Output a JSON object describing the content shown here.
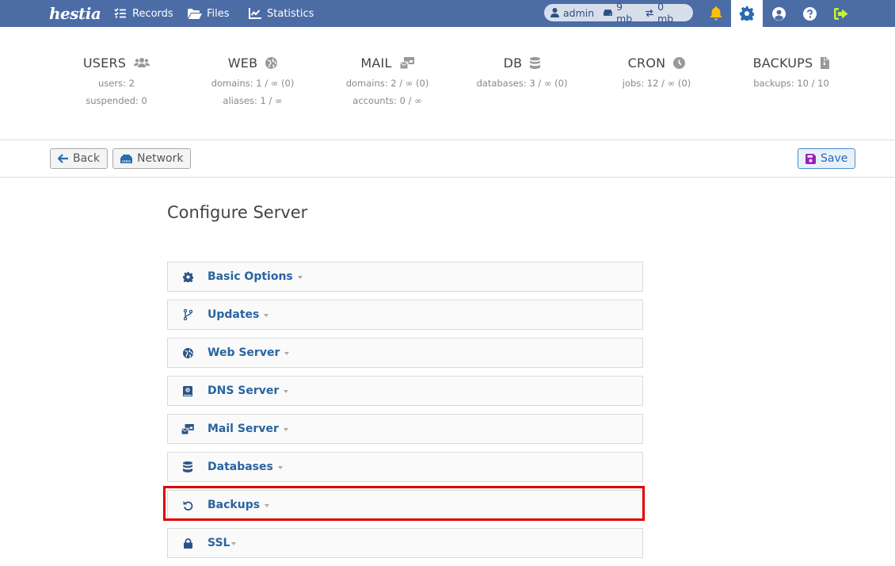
{
  "topbar": {
    "logo": "hestia",
    "nav": [
      {
        "label": "Records",
        "icon": "list-check-icon"
      },
      {
        "label": "Files",
        "icon": "folder-open-icon"
      },
      {
        "label": "Statistics",
        "icon": "chart-line-icon"
      }
    ],
    "user_pill": {
      "user": "admin",
      "disk": "9 mb",
      "bandwidth": "0 mb"
    },
    "icons": [
      "bell-icon",
      "gear-icon",
      "user-circle-icon",
      "help-icon",
      "logout-icon"
    ],
    "colors": {
      "bar": "#4c6ca6",
      "bell": "#ffc107",
      "logout": "#c6f03a",
      "active_gear": "#2a6ab0"
    }
  },
  "stats": [
    {
      "title": "USERS",
      "icon": "users-icon",
      "lines": [
        "users: 2",
        "suspended: 0"
      ]
    },
    {
      "title": "WEB",
      "icon": "globe-icon",
      "lines": [
        "domains: 1 / ∞ (0)",
        "aliases: 1 / ∞"
      ]
    },
    {
      "title": "MAIL",
      "icon": "mail-bulk-icon",
      "lines": [
        "domains: 2 / ∞ (0)",
        "accounts: 0 / ∞"
      ]
    },
    {
      "title": "DB",
      "icon": "database-icon",
      "lines": [
        "databases: 3 / ∞ (0)"
      ]
    },
    {
      "title": "CRON",
      "icon": "clock-icon",
      "lines": [
        "jobs: 12 / ∞ (0)"
      ]
    },
    {
      "title": "BACKUPS",
      "icon": "file-archive-icon",
      "lines": [
        "backups: 10 / 10"
      ]
    }
  ],
  "toolbar": {
    "back_label": "Back",
    "network_label": "Network",
    "save_label": "Save"
  },
  "page": {
    "title": "Configure Server",
    "sections": [
      {
        "label": "Basic Options",
        "icon": "gear-icon"
      },
      {
        "label": "Updates",
        "icon": "code-branch-icon"
      },
      {
        "label": "Web Server",
        "icon": "globe-icon"
      },
      {
        "label": "DNS Server",
        "icon": "address-book-icon"
      },
      {
        "label": "Mail Server",
        "icon": "mail-bulk-icon"
      },
      {
        "label": "Databases",
        "icon": "database-icon"
      },
      {
        "label": "Backups",
        "icon": "rotate-left-icon",
        "highlighted": true
      },
      {
        "label": "SSL",
        "icon": "lock-icon"
      }
    ]
  }
}
